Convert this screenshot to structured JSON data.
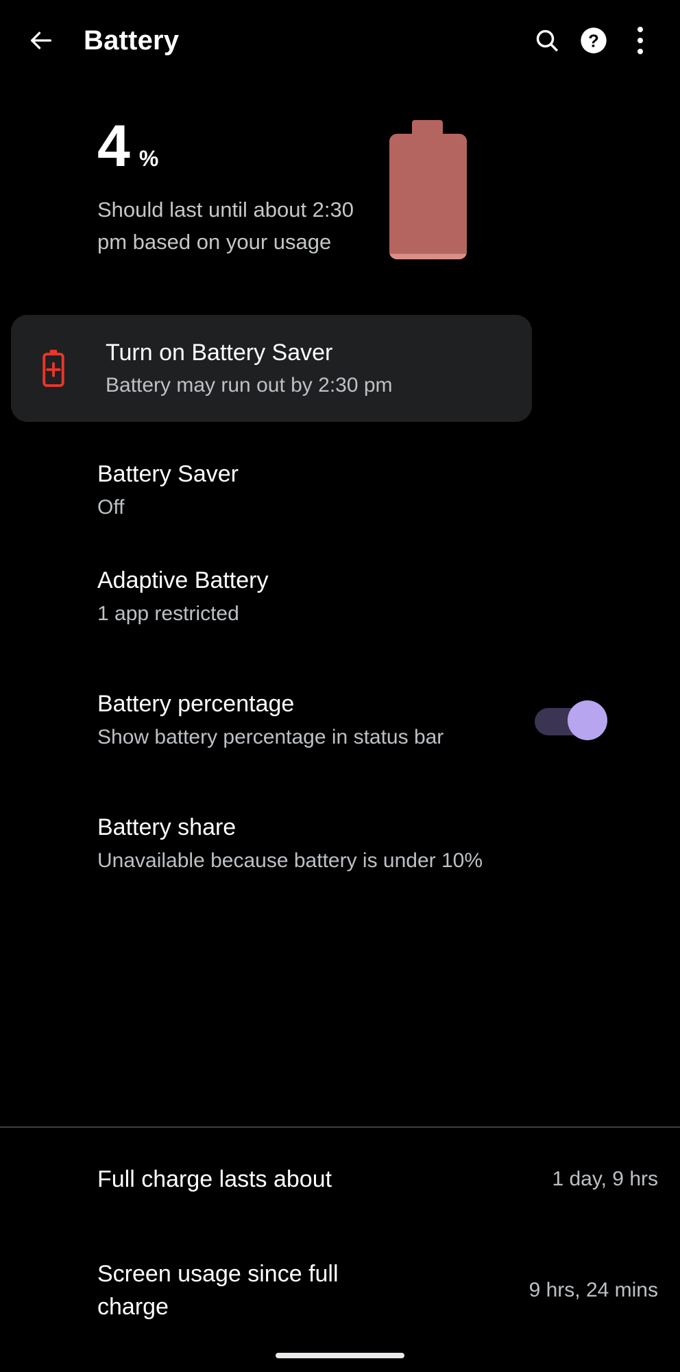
{
  "appbar": {
    "back_icon": "arrow-back-icon",
    "title": "Battery",
    "search_icon": "search-icon",
    "help_icon": "help-icon",
    "overflow_icon": "more-vert-icon"
  },
  "hero": {
    "percent_value": "4",
    "percent_sign": "%",
    "estimate": "Should last until about 2:30 pm based on your usage",
    "battery_icon": "battery-level-icon",
    "battery_color": "#b5655f",
    "battery_fill_color": "#d99089"
  },
  "suggestion": {
    "icon": "battery-saver-plus-icon",
    "icon_color": "#e8372a",
    "title": "Turn on Battery Saver",
    "subtitle": "Battery may run out by 2:30 pm",
    "card_color": "#1f2022"
  },
  "settings": [
    {
      "name": "battery-saver",
      "title": "Battery Saver",
      "subtitle": "Off"
    },
    {
      "name": "adaptive-battery",
      "title": "Adaptive Battery",
      "subtitle": "1 app restricted"
    },
    {
      "name": "battery-percentage",
      "title": "Battery percentage",
      "subtitle": "Show battery percentage in status bar",
      "toggle_state": "on",
      "toggle_thumb_color": "#b7a5f0",
      "toggle_track_color": "#3b3553"
    },
    {
      "name": "battery-share",
      "title": "Battery share",
      "subtitle": "Unavailable because battery is under 10%"
    }
  ],
  "stats": [
    {
      "name": "full-charge-lasts-about",
      "label": "Full charge lasts about",
      "value": "1 day, 9 hrs"
    },
    {
      "name": "screen-usage-since-full-charge",
      "label": "Screen usage since full charge",
      "value": "9 hrs, 24 mins"
    }
  ],
  "system": {
    "gesture_bar": "home-gesture-bar"
  }
}
